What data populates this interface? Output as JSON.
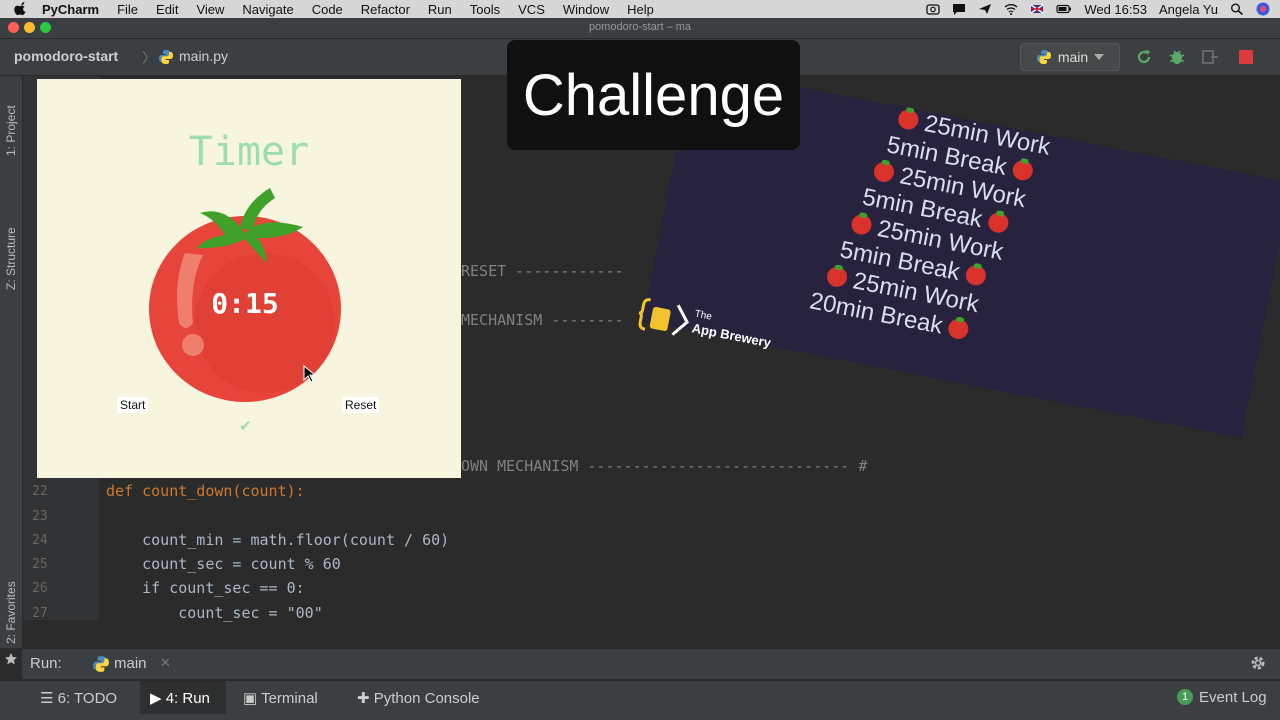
{
  "menubar": {
    "app": "PyCharm",
    "items": [
      "File",
      "Edit",
      "View",
      "Navigate",
      "Code",
      "Refactor",
      "Run",
      "Tools",
      "VCS",
      "Window",
      "Help"
    ],
    "clock": "Wed 16:53",
    "user": "Angela Yu"
  },
  "window": {
    "title": "pomodoro-start – ma"
  },
  "breadcrumb": {
    "project": "pomodoro-start",
    "file": "main.py"
  },
  "run_config": {
    "label": "main"
  },
  "left_stripe": {
    "project": "1: Project",
    "structure": "Z: Structure",
    "favorites": "2: Favorites"
  },
  "editor": {
    "fragments": {
      "reset": "RESET ------------",
      "mechanism": "MECHANISM --------",
      "countdown": "OWN MECHANISM ----------------------------- #"
    },
    "lines": [
      {
        "num": "22",
        "code": "def count_down(count):"
      },
      {
        "num": "23",
        "code": ""
      },
      {
        "num": "24",
        "code": "    count_min = math.floor(count / 60)"
      },
      {
        "num": "25",
        "code": "    count_sec = count % 60"
      },
      {
        "num": "26",
        "code": "    if count_sec == 0:"
      },
      {
        "num": "27",
        "code": "        count_sec = \"00\""
      }
    ]
  },
  "run_panel": {
    "label": "Run:",
    "tab": "main"
  },
  "tool_windows": {
    "todo": "6: TODO",
    "run": "4: Run",
    "terminal": "Terminal",
    "python_console": "Python Console",
    "event_log": "Event Log",
    "event_count": "1"
  },
  "tk_app": {
    "title": "Timer",
    "time": "0:15",
    "start": "Start",
    "reset": "Reset",
    "check": "✔"
  },
  "challenge": {
    "heading": "Challenge",
    "plan": [
      "25min Work",
      "5min Break",
      "25min Work",
      "5min Break",
      "25min Work",
      "5min Break",
      "25min Work",
      "20min Break"
    ],
    "logo_small": "The",
    "logo_big": "App Brewery"
  },
  "colors": {
    "accent_green": "#9bdeac",
    "tomato": "#e7453a",
    "navy": "#27233f",
    "editor_bg": "#2b2b2b"
  }
}
